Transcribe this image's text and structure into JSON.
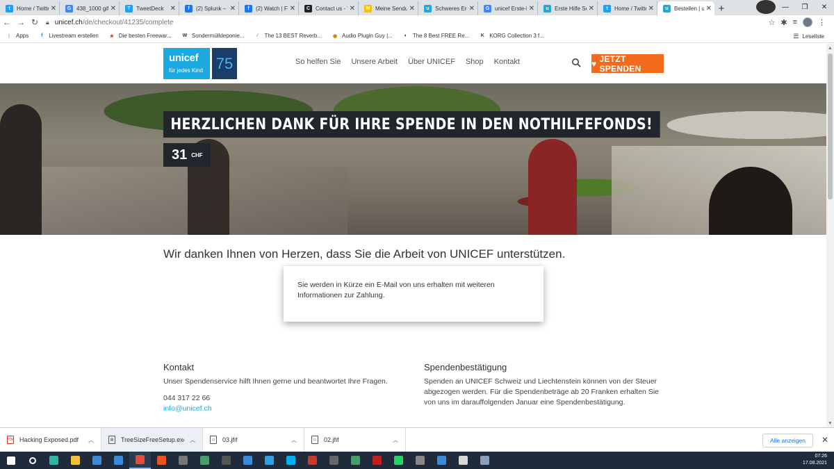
{
  "browser": {
    "tabs": [
      {
        "title": "Home / Twitter",
        "color": "#1da1f2",
        "glyph": "t"
      },
      {
        "title": "438_1000 gif",
        "color": "#4285f4",
        "glyph": "G"
      },
      {
        "title": "TweetDeck",
        "color": "#1da1f2",
        "glyph": "T"
      },
      {
        "title": "(2) Splunk – B",
        "color": "#1877f2",
        "glyph": "f"
      },
      {
        "title": "(2) Watch | Fa",
        "color": "#1877f2",
        "glyph": "f"
      },
      {
        "title": "Contact us - V",
        "color": "#222222",
        "glyph": "C"
      },
      {
        "title": "Meine Sendun",
        "color": "#f5c400",
        "glyph": "M"
      },
      {
        "title": "Schweres Erdb",
        "color": "#1ca9e1",
        "glyph": "u"
      },
      {
        "title": "unicef Erste-H",
        "color": "#4285f4",
        "glyph": "G"
      },
      {
        "title": "Erste Hilfe Set",
        "color": "#1ca9e1",
        "glyph": "u"
      },
      {
        "title": "Home / Twitte",
        "color": "#1da1f2",
        "glyph": "t"
      },
      {
        "title": "Bestellen | uni",
        "color": "#1ca9e1",
        "glyph": "u"
      }
    ],
    "url_domain": "unicef.ch",
    "url_path": "/de/checkout/41235/complete",
    "bookmarks": [
      {
        "label": "Apps",
        "color": "#e94235",
        "glyph": "⋮"
      },
      {
        "label": "Livestream erstellen",
        "color": "#1877f2",
        "glyph": "f"
      },
      {
        "label": "Die besten Freewar...",
        "color": "#d93025",
        "glyph": "★"
      },
      {
        "label": "Sondermülldeponie...",
        "color": "#333333",
        "glyph": "W"
      },
      {
        "label": "The 13 BEST Reverb...",
        "color": "#5b7bd5",
        "glyph": "∕"
      },
      {
        "label": "Audio Plugin Guy |...",
        "color": "#c47a00",
        "glyph": "◉"
      },
      {
        "label": "The 8 Best FREE Re...",
        "color": "#222222",
        "glyph": "◐"
      },
      {
        "label": "KORG Collection 3 f...",
        "color": "#444444",
        "glyph": "K"
      }
    ],
    "reading_list": "Leseliste"
  },
  "site": {
    "logo_text": "unicef",
    "logo_sub": "für jedes Kind",
    "logo_75": "75",
    "nav": [
      "So helfen Sie",
      "Unsere Arbeit",
      "Über UNICEF",
      "Shop",
      "Kontakt"
    ],
    "donate_button": "JETZT SPENDEN",
    "hero_title": "HERZLICHEN DANK FÜR IHRE SPENDE IN DEN NOTHILFEFONDS!",
    "amount": "31",
    "currency": "CHF",
    "thanks_heading": "Wir danken Ihnen von Herzen, dass Sie die Arbeit von UNICEF unterstützen.",
    "info_message": "Sie werden in Kürze ein E-Mail von uns erhalten mit weiteren Informationen zur Zahlung.",
    "contact": {
      "heading": "Kontakt",
      "text": "Unser Spendenservice hilft Ihnen gerne und beantwortet Ihre Fragen.",
      "phone": "044 317 22 66",
      "email": "info@unicef.ch"
    },
    "receipt": {
      "heading": "Spendenbestätigung",
      "text": "Spenden an UNICEF Schweiz und Liechtenstein können von der Steuer abgezogen werden. Für die Spendenbeträge ab 20 Franken erhalten Sie von uns im darauffolgenden Januar eine Spendenbestätigung."
    }
  },
  "downloads": {
    "items": [
      {
        "name": "Hacking Exposed.pdf",
        "icon": "pdf-icon"
      },
      {
        "name": "TreeSizeFreeSetup.exe",
        "icon": "exe-icon"
      },
      {
        "name": "03.jfif",
        "icon": "image-file-icon"
      },
      {
        "name": "02.jfif",
        "icon": "image-file-icon"
      }
    ],
    "show_all": "Alle anzeigen"
  },
  "taskbar": {
    "time": "07:26",
    "date": "17.08.2021",
    "apps": [
      {
        "name": "start-icon",
        "color": "#ffffff"
      },
      {
        "name": "search-icon",
        "color": "#ffffff"
      },
      {
        "name": "edge-icon",
        "color": "#2fb5a1"
      },
      {
        "name": "explorer-icon",
        "color": "#f3c13a"
      },
      {
        "name": "store-icon",
        "color": "#3b8bd9"
      },
      {
        "name": "mail-icon",
        "color": "#3b8bd9"
      },
      {
        "name": "chrome-icon",
        "color": "#e84b3c"
      },
      {
        "name": "ubuntu-icon",
        "color": "#e95420"
      },
      {
        "name": "tool-icon",
        "color": "#777777"
      },
      {
        "name": "vpn-icon",
        "color": "#4a9c6b"
      },
      {
        "name": "live-icon",
        "color": "#555555"
      },
      {
        "name": "photos-icon",
        "color": "#3b8bd9"
      },
      {
        "name": "telegram-icon",
        "color": "#2aa3e0"
      },
      {
        "name": "skype-icon",
        "color": "#00aff0"
      },
      {
        "name": "app-icon",
        "color": "#c83b2a"
      },
      {
        "name": "keyboard-icon",
        "color": "#666666"
      },
      {
        "name": "snip-icon",
        "color": "#4a9c6b"
      },
      {
        "name": "tweetdeck-icon",
        "color": "#c21f1f"
      },
      {
        "name": "whatsapp-icon",
        "color": "#25d366"
      },
      {
        "name": "media-icon",
        "color": "#888888"
      },
      {
        "name": "window-icon",
        "color": "#3b8bd9"
      },
      {
        "name": "notes-icon",
        "color": "#d8d8d8"
      },
      {
        "name": "calc-icon",
        "color": "#8aa0b8"
      }
    ]
  }
}
